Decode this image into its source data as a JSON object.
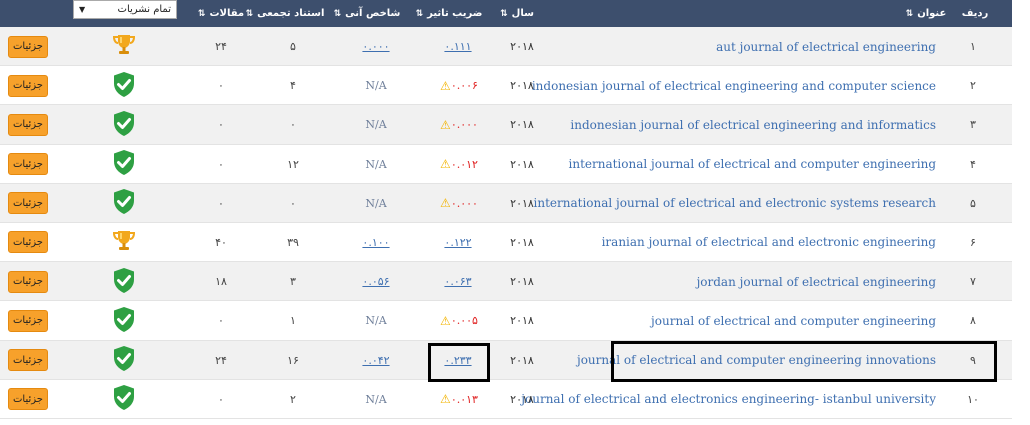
{
  "header": {
    "row_label": "ردیف",
    "title_label": "عنوان",
    "year_label": "سال",
    "impact_label": "ضریب تاثیر",
    "instant_label": "شاخص آنی",
    "citations_label": "استناد تجمعی",
    "articles_label": "مقالات",
    "sort_glyph": "⇅",
    "filter_value": "تمام نشریات",
    "filter_icon": "chevron-down-icon"
  },
  "colors": {
    "header_bg": "#3d4f6d",
    "link": "#3e6fb0",
    "warning": "#e02020",
    "button": "#f7a12b",
    "status_green": "#2ea043",
    "trophy": "#f2a81d"
  },
  "rows": [
    {
      "num": "۱",
      "title": "aut journal of electrical engineering",
      "year": "۲۰۱۸",
      "impact": "۰.۱۱۱",
      "impact_style": "link",
      "instant": "۰.۰۰۰",
      "instant_style": "link",
      "citations": "۵",
      "articles": "۲۴",
      "status": "trophy-icon",
      "button": "جزئیات"
    },
    {
      "num": "۲",
      "title": "indonesian journal of electrical engineering and computer science",
      "year": "۲۰۱۸",
      "impact": "۰.۰۰۶",
      "impact_style": "warn",
      "instant": "N/A",
      "instant_style": "na",
      "citations": "۴",
      "articles": "۰",
      "status": "shield-check-icon",
      "button": "جزئیات"
    },
    {
      "num": "۳",
      "title": "indonesian journal of electrical engineering and informatics",
      "year": "۲۰۱۸",
      "impact": "۰.۰۰۰",
      "impact_style": "warn",
      "instant": "N/A",
      "instant_style": "na",
      "citations": "۰",
      "articles": "۰",
      "status": "shield-check-icon",
      "button": "جزئیات"
    },
    {
      "num": "۴",
      "title": "international journal of electrical and computer engineering",
      "year": "۲۰۱۸",
      "impact": "۰.۰۱۲",
      "impact_style": "warn",
      "instant": "N/A",
      "instant_style": "na",
      "citations": "۱۲",
      "articles": "۰",
      "status": "shield-check-icon",
      "button": "جزئیات"
    },
    {
      "num": "۵",
      "title": "international journal of electrical and electronic systems research",
      "year": "۲۰۱۸",
      "impact": "۰.۰۰۰",
      "impact_style": "warn",
      "instant": "N/A",
      "instant_style": "na",
      "citations": "۰",
      "articles": "۰",
      "status": "shield-check-icon",
      "button": "جزئیات"
    },
    {
      "num": "۶",
      "title": "iranian journal of electrical and electronic engineering",
      "year": "۲۰۱۸",
      "impact": "۰.۱۲۲",
      "impact_style": "link",
      "instant": "۰.۱۰۰",
      "instant_style": "link",
      "citations": "۳۹",
      "articles": "۴۰",
      "status": "trophy-icon",
      "button": "جزئیات"
    },
    {
      "num": "۷",
      "title": "jordan journal of electrical engineering",
      "year": "۲۰۱۸",
      "impact": "۰.۰۶۳",
      "impact_style": "link",
      "instant": "۰.۰۵۶",
      "instant_style": "link",
      "citations": "۳",
      "articles": "۱۸",
      "status": "shield-check-icon",
      "button": "جزئیات"
    },
    {
      "num": "۸",
      "title": "journal of electrical and computer engineering",
      "year": "۲۰۱۸",
      "impact": "۰.۰۰۵",
      "impact_style": "warn",
      "instant": "N/A",
      "instant_style": "na",
      "citations": "۱",
      "articles": "۰",
      "status": "shield-check-icon",
      "button": "جزئیات"
    },
    {
      "num": "۹",
      "title": "journal of electrical and computer engineering innovations",
      "year": "۲۰۱۸",
      "impact": "۰.۲۳۳",
      "impact_style": "link",
      "instant": "۰.۰۴۲",
      "instant_style": "link",
      "citations": "۱۶",
      "articles": "۲۴",
      "status": "shield-check-icon",
      "button": "جزئیات"
    },
    {
      "num": "۱۰",
      "title": "journal of electrical and electronics engineering- istanbul university",
      "year": "۲۰۱۸",
      "impact": "۰.۰۱۳",
      "impact_style": "warn",
      "instant": "N/A",
      "instant_style": "na",
      "citations": "۲",
      "articles": "۰",
      "status": "shield-check-icon",
      "button": "جزئیات"
    }
  ]
}
